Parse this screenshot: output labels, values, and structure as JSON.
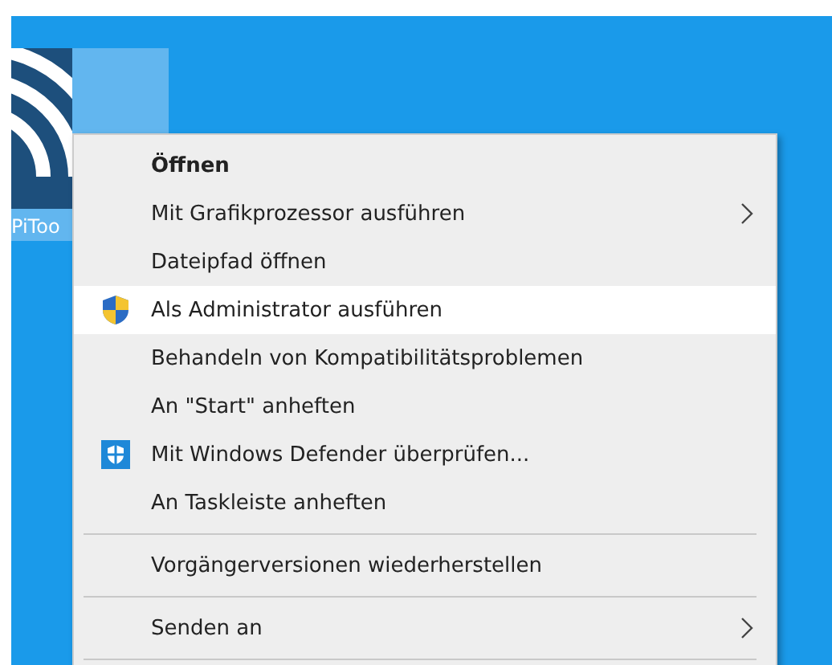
{
  "desktop_icon": {
    "label": "PiToo",
    "selected": true
  },
  "context_menu": {
    "items": [
      {
        "kind": "plain",
        "label": "Öffnen",
        "bold": true,
        "submenu": false,
        "selected": false
      },
      {
        "kind": "plain",
        "label": "Mit Grafikprozessor ausführen",
        "bold": false,
        "submenu": true,
        "selected": false
      },
      {
        "kind": "plain",
        "label": "Dateipfad öffnen",
        "bold": false,
        "submenu": false,
        "selected": false
      },
      {
        "kind": "admin",
        "label": "Als Administrator ausführen",
        "bold": false,
        "submenu": false,
        "selected": true
      },
      {
        "kind": "plain",
        "label": "Behandeln von Kompatibilitätsproblemen",
        "bold": false,
        "submenu": false,
        "selected": false
      },
      {
        "kind": "plain",
        "label": "An \"Start\" anheften",
        "bold": false,
        "submenu": false,
        "selected": false
      },
      {
        "kind": "scan",
        "label": "Mit Windows Defender überprüfen...",
        "bold": false,
        "submenu": false,
        "selected": false
      },
      {
        "kind": "plain",
        "label": "An Taskleiste anheften",
        "bold": false,
        "submenu": false,
        "selected": false
      },
      {
        "kind": "separator"
      },
      {
        "kind": "plain",
        "label": "Vorgängerversionen wiederherstellen",
        "bold": false,
        "submenu": false,
        "selected": false
      },
      {
        "kind": "separator"
      },
      {
        "kind": "plain",
        "label": "Senden an",
        "bold": false,
        "submenu": true,
        "selected": false
      },
      {
        "kind": "separator"
      }
    ]
  }
}
